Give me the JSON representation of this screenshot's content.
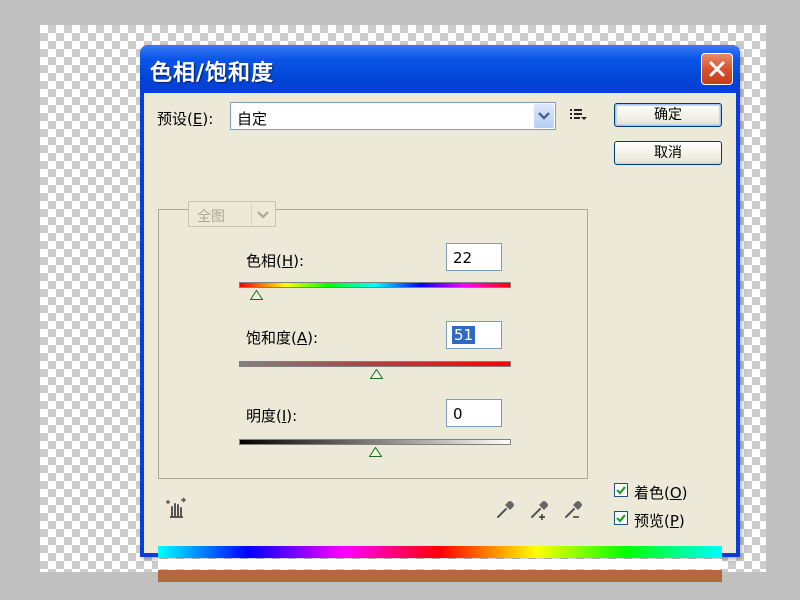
{
  "dialog": {
    "title": "色相/饱和度",
    "preset_label_pre": "预设(",
    "preset_label_key": "E",
    "preset_label_post": "):",
    "preset_value": "自定",
    "ok_label": "确定",
    "cancel_label": "取消"
  },
  "edit": {
    "range_value": "全图"
  },
  "hue": {
    "label_pre": "色相(",
    "label_key": "H",
    "label_post": "):",
    "value": "22",
    "slider_level": 0.065
  },
  "saturation": {
    "label_pre": "饱和度(",
    "label_key": "A",
    "label_post": "):",
    "value": "51",
    "slider_level": 0.505
  },
  "lightness": {
    "label_pre": "明度(",
    "label_key": "I",
    "label_post": "):",
    "value": "0",
    "slider_level": 0.5
  },
  "options": {
    "colorize_pre": "着色(",
    "colorize_key": "O",
    "colorize_post": ")",
    "colorize_checked": true,
    "preview_pre": "预览(",
    "preview_key": "P",
    "preview_post": ")",
    "preview_checked": true
  },
  "colors": {
    "title_bar": "#0a3dd8",
    "close_button": "#d9532d",
    "selection": "#316ac5",
    "result_bar": "#b5683e",
    "checkbox_mark": "#21a121"
  },
  "icons": {
    "close": "close-icon",
    "menu": "list-menu-icon",
    "hand": "hand-adjust-icon",
    "eyedropper": "eyedropper-icon",
    "eyedropper_add": "eyedropper-plus-icon",
    "eyedropper_subtract": "eyedropper-minus-icon"
  }
}
